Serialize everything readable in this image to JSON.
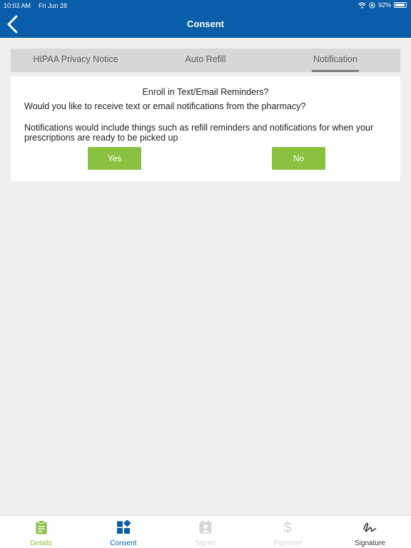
{
  "status_bar": {
    "time": "10:03 AM",
    "date": "Fri Jun 28",
    "battery": "92%",
    "battery_level": 0.92
  },
  "header": {
    "title": "Consent"
  },
  "tabs": [
    {
      "label": "HIPAA Privacy Notice"
    },
    {
      "label": "Auto Refill"
    },
    {
      "label": "Notification"
    }
  ],
  "active_tab": 2,
  "card": {
    "title": "Enroll in Text/Email Reminders?",
    "question": "Would you like to receive text or email notifications from the pharmacy?",
    "description": "Notifications would include things such as refill reminders and notifications for when your prescriptions are ready to be picked up",
    "yes_label": "Yes",
    "no_label": "No"
  },
  "bottom_nav": [
    {
      "label": "Details",
      "icon": "clipboard-icon",
      "color": "#8bc140"
    },
    {
      "label": "Consent",
      "icon": "grid-icon",
      "color": "#0a5da8"
    },
    {
      "label": "Signer",
      "icon": "badge-icon",
      "color": "#d4d4d4"
    },
    {
      "label": "Payment",
      "icon": "dollar-icon",
      "color": "#d4d4d4"
    },
    {
      "label": "Signature",
      "icon": "signature-icon",
      "color": "#333333"
    }
  ],
  "colors": {
    "header": "#0a5da8",
    "accent": "#8bc140"
  }
}
